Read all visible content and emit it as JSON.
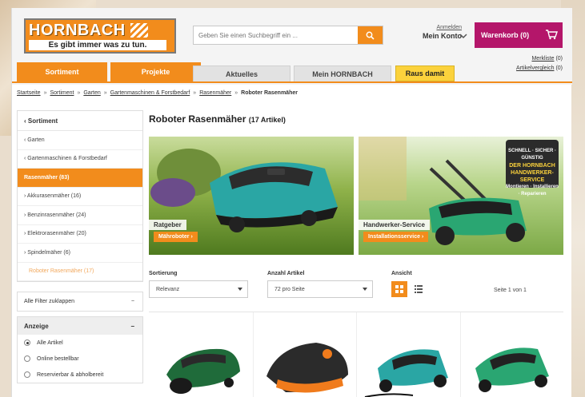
{
  "brand": {
    "logo_word": "HORNBACH",
    "slogan": "Es gibt immer was zu tun."
  },
  "search": {
    "placeholder": "Geben Sie einen Suchbegriff ein ..."
  },
  "account": {
    "login": "Anmelden",
    "my_account": "Mein Konto"
  },
  "cart": {
    "label": "Warenkorb (0)"
  },
  "util_links": {
    "wishlist": "Merkliste",
    "wishlist_count": "(0)",
    "compare": "Artikelvergleich",
    "compare_count": "(0)"
  },
  "nav": {
    "tabs": [
      {
        "label": "Sortiment"
      },
      {
        "label": "Projekte"
      },
      {
        "label": "Aktuelles"
      },
      {
        "label": "Mein HORNBACH"
      },
      {
        "label": "Raus damit"
      }
    ]
  },
  "breadcrumb": {
    "items": [
      "Startseite",
      "Sortiment",
      "Garten",
      "Gartenmaschinen & Forstbedarf",
      "Rasenmäher"
    ],
    "separator": "»",
    "current": "Roboter Rasenmäher"
  },
  "sidebar": {
    "heading": "‹ Sortiment",
    "items": [
      {
        "label": "‹ Garten"
      },
      {
        "label": "‹ Gartenmaschinen & Forstbedarf"
      },
      {
        "label": "Rasenmäher (83)"
      },
      {
        "label": "› Akkurasenmäher (16)"
      },
      {
        "label": "› Benzinrasenmäher (24)"
      },
      {
        "label": "› Elektrorasenmäher (20)"
      },
      {
        "label": "› Spindelmäher (6)"
      },
      {
        "label": "Roboter Rasenmäher (17)"
      }
    ],
    "collapse_filters": "Alle Filter zuklappen",
    "display_heading": "Anzeige",
    "display_options": [
      {
        "label": "Alle Artikel",
        "selected": true
      },
      {
        "label": "Online bestellbar",
        "selected": false
      },
      {
        "label": "Reservierbar & abholbereit",
        "selected": false
      }
    ]
  },
  "main": {
    "title": "Roboter Rasenmäher",
    "count": "(17 Artikel)",
    "banners": [
      {
        "caption": "Ratgeber",
        "link": "Mähroboter ›"
      },
      {
        "caption": "Handwerker-Service",
        "link": "Installationsservice ›",
        "badge_top": "SCHNELL · SICHER · GÜNSTIG",
        "badge_title": "DER HORNBACH HANDWERKER-SERVICE",
        "badge_sub": "Montieren · Installieren · Reparieren"
      }
    ],
    "sort": {
      "label": "Sortierung",
      "value": "Relevanz"
    },
    "per_page": {
      "label": "Anzahl Artikel",
      "value": "72 pro Seite"
    },
    "view": {
      "label": "Ansicht"
    },
    "page_info": "Seite 1 von 1"
  },
  "colors": {
    "accent": "#f28c1c",
    "cart": "#b4166a",
    "highlight": "#fbd23c"
  }
}
